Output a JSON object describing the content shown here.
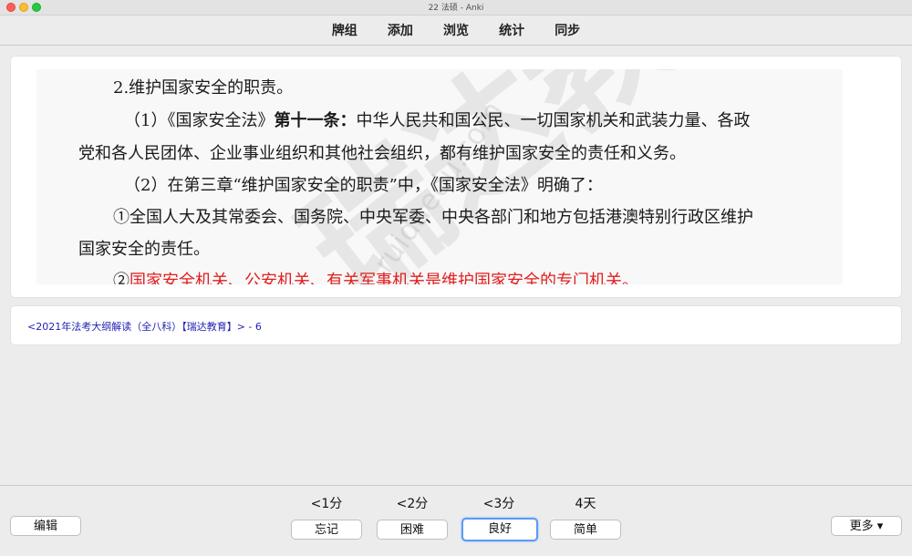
{
  "window": {
    "title": "22 法硕 - Anki"
  },
  "toolbar": {
    "items": [
      "牌组",
      "添加",
      "浏览",
      "统计",
      "同步"
    ]
  },
  "card": {
    "watermark": "瑞达教",
    "watermark_url": "ruidaedu.com",
    "line1": "2.维护国家安全的职责。",
    "line2_prefix": "（1）《国家安全法》",
    "line2_bold": "第十一条：",
    "line2_rest": "中华人民共和国公民、一切国家机关和武装力量、各政",
    "line3": "党和各人民团体、企业事业组织和其他社会组织，都有维护国家安全的责任和义务。",
    "line4": "（2）在第三章“维护国家安全的职责”中，《国家安全法》明确了：",
    "line5": "①全国人大及其常委会、国务院、中央军委、中央各部门和地方包括港澳特别行政区维护",
    "line6": "国家安全的责任。",
    "line7_prefix": "②",
    "line7_red": "国家安全机关、公安机关、有关军事机关是维护国家安全的专门机关。"
  },
  "source": {
    "text": "<2021年法考大纲解读（全八科）【瑞达教育】> - 6"
  },
  "bottom": {
    "edit_label": "编辑",
    "more_label": "更多 ▾",
    "answers": [
      {
        "interval": "<1分",
        "label": "忘记"
      },
      {
        "interval": "<2分",
        "label": "困难"
      },
      {
        "interval": "<3分",
        "label": "良好"
      },
      {
        "interval": "4天",
        "label": "简单"
      }
    ]
  }
}
